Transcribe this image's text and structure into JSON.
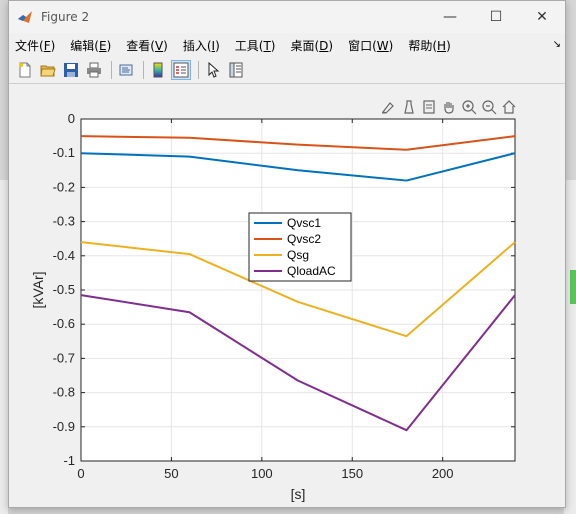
{
  "window": {
    "title": "Figure 2"
  },
  "window_controls": {
    "minimize": "—",
    "maximize": "☐",
    "close": "✕"
  },
  "menu": [
    {
      "label": "文件(",
      "key": "F",
      "end": ")"
    },
    {
      "label": "编辑(",
      "key": "E",
      "end": ")"
    },
    {
      "label": "查看(",
      "key": "V",
      "end": ")"
    },
    {
      "label": "插入(",
      "key": "I",
      "end": ")"
    },
    {
      "label": "工具(",
      "key": "T",
      "end": ")"
    },
    {
      "label": "桌面(",
      "key": "D",
      "end": ")"
    },
    {
      "label": "窗口(",
      "key": "W",
      "end": ")"
    },
    {
      "label": "帮助(",
      "key": "H",
      "end": ")"
    }
  ],
  "toolbar_icons": [
    "new-figure-icon",
    "open-folder-icon",
    "save-icon",
    "print-icon",
    "link-icon",
    "colorbar-icon",
    "legend-icon",
    "pointer-icon",
    "property-editor-icon"
  ],
  "axes_toolbar_icons": [
    "brush-icon",
    "data-cursor-icon",
    "restore-icon",
    "pan-icon",
    "zoom-in-icon",
    "zoom-out-icon",
    "home-icon"
  ],
  "colors": {
    "Qvsc1": "#0072BD",
    "Qvsc2": "#D95319",
    "Qsg": "#EDB120",
    "QloadAC": "#7E2F8E"
  },
  "chart_data": {
    "type": "line",
    "title": "",
    "xlabel": "[s]",
    "ylabel": "[kVAr]",
    "xlim": [
      0,
      240
    ],
    "ylim": [
      -1,
      0
    ],
    "xticks": [
      0,
      50,
      100,
      150,
      200
    ],
    "yticks": [
      0,
      -0.1,
      -0.2,
      -0.3,
      -0.4,
      -0.5,
      -0.6,
      -0.7,
      -0.8,
      -0.9,
      -1
    ],
    "xtick_labels": [
      "0",
      "50",
      "100",
      "150",
      "200"
    ],
    "ytick_labels": [
      "0",
      "-0.1",
      "-0.2",
      "-0.3",
      "-0.4",
      "-0.5",
      "-0.6",
      "-0.7",
      "-0.8",
      "-0.9",
      "-1"
    ],
    "grid": true,
    "legend_position": "center",
    "x": [
      0,
      60,
      120,
      180,
      240
    ],
    "series": [
      {
        "name": "Qvsc1",
        "values": [
          -0.1,
          -0.11,
          -0.15,
          -0.18,
          -0.1
        ]
      },
      {
        "name": "Qvsc2",
        "values": [
          -0.05,
          -0.055,
          -0.075,
          -0.09,
          -0.05
        ]
      },
      {
        "name": "Qsg",
        "values": [
          -0.36,
          -0.395,
          -0.535,
          -0.635,
          -0.36
        ]
      },
      {
        "name": "QloadAC",
        "values": [
          -0.515,
          -0.565,
          -0.765,
          -0.91,
          -0.515
        ]
      }
    ]
  }
}
